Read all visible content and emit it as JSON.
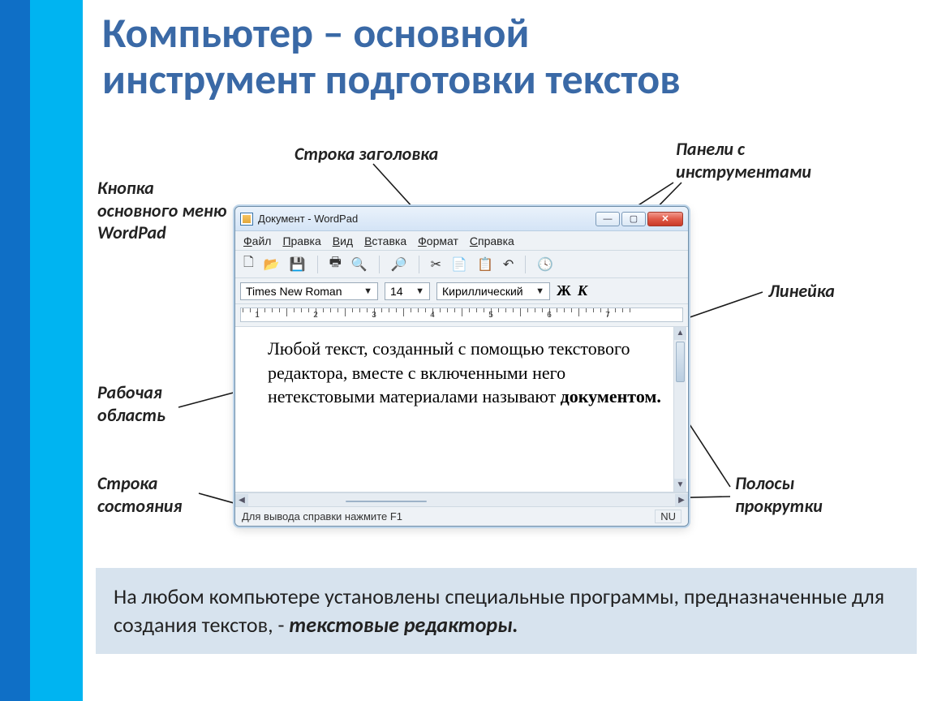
{
  "title_line1": "Компьютер – основной",
  "title_line2": "инструмент подготовки текстов",
  "callouts": {
    "title_bar": "Строка заголовка",
    "toolbars": "Панели  с\nинструментами",
    "main_menu": "Кнопка\nосновного меню\nWordPad",
    "ruler": "Линейка",
    "work_area": "Рабочая\nобласть",
    "status_bar": "Строка\nсостояния",
    "scrollbars": "Полосы\nпрокрутки"
  },
  "wordpad": {
    "title": "Документ - WordPad",
    "menu": [
      "Файл",
      "Правка",
      "Вид",
      "Вставка",
      "Формат",
      "Справка"
    ],
    "font_name": "Times New Roman",
    "font_size": "14",
    "script": "Кириллический",
    "bold_glyph": "Ж",
    "italic_glyph": "К",
    "ruler_numbers": [
      "1",
      "2",
      "3",
      "4",
      "5",
      "6",
      "7"
    ],
    "doc_text": "Любой текст, созданный с помощью текстового редактора, вместе с включенными него нетекстовыми материалами называют ",
    "doc_bold": "документом.",
    "status_text": "Для вывода справки нажмите F1",
    "status_indicator": "NU",
    "toolbar_icons": [
      "new",
      "open",
      "save",
      "print",
      "preview",
      "find",
      "cut",
      "copy",
      "paste",
      "undo",
      "datetime"
    ]
  },
  "caption_text": "На любом компьютере установлены специальные программы, предназначенные для создания текстов, -",
  "caption_em": "текстовые редакторы."
}
